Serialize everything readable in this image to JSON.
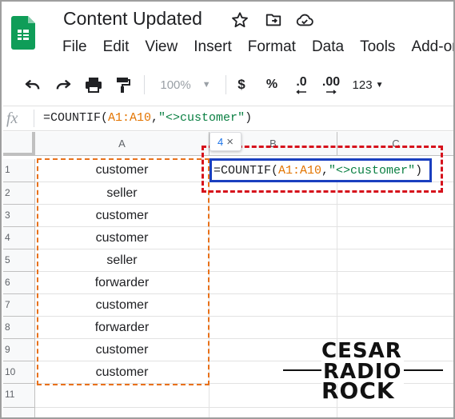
{
  "title_bar": {
    "doc_title": "Content Updated"
  },
  "menu": [
    "File",
    "Edit",
    "View",
    "Insert",
    "Format",
    "Data",
    "Tools",
    "Add-or"
  ],
  "toolbar": {
    "zoom": "100%",
    "currency": "$",
    "percent": "%",
    "decrease_decimal": ".0",
    "increase_decimal": ".00",
    "more_formats": "123"
  },
  "formula_bar": {
    "fx_label": "fx",
    "formula_prefix": "=COUNTIF(",
    "formula_ref": "A1:A10",
    "formula_comma": ",",
    "formula_string": "\"<>customer\"",
    "formula_suffix": ")"
  },
  "columns": [
    "A",
    "B",
    "C"
  ],
  "rows": [
    "1",
    "2",
    "3",
    "4",
    "5",
    "6",
    "7",
    "8",
    "9",
    "10",
    "11"
  ],
  "column_a": [
    "customer",
    "seller",
    "customer",
    "customer",
    "seller",
    "forwarder",
    "customer",
    "forwarder",
    "customer",
    "customer"
  ],
  "result_tooltip": {
    "value": "4",
    "close": "×"
  },
  "watermark": {
    "line1": "CESAR",
    "line2": "RADIO",
    "line3": "ROCK"
  },
  "colors": {
    "selection_range": "#e8711a",
    "active_cell_border": "#1a3fbf",
    "highlight_box": "#d6121c",
    "reference_text": "#e37400",
    "string_text": "#0b8043",
    "sheets_green": "#0f9d58"
  },
  "icons": {
    "star": "star-icon",
    "move": "move-to-folder-icon",
    "cloud": "cloud-saved-icon",
    "undo": "undo-icon",
    "redo": "redo-icon",
    "print": "print-icon",
    "paint_format": "paint-format-icon"
  }
}
